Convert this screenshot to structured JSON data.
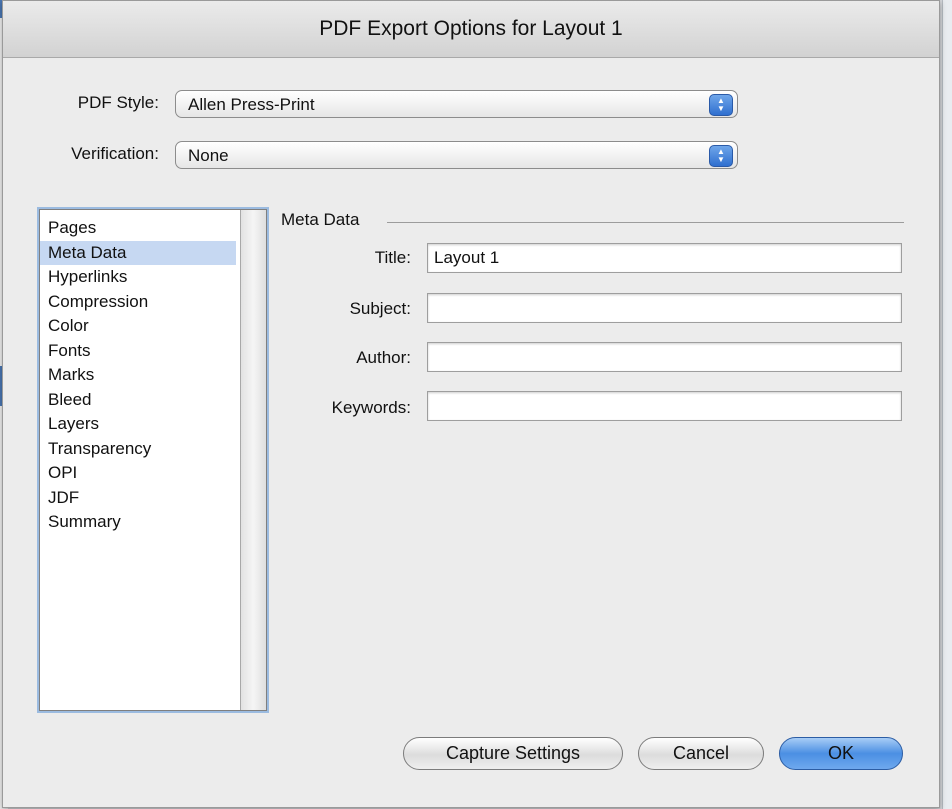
{
  "dialog": {
    "title": "PDF Export Options for Layout 1"
  },
  "pdf_style": {
    "label": "PDF Style:",
    "value": "Allen Press-Print"
  },
  "verification": {
    "label": "Verification:",
    "value": "None"
  },
  "panel_list": {
    "items": [
      {
        "label": "Pages",
        "selected": false
      },
      {
        "label": "Meta Data",
        "selected": true
      },
      {
        "label": "Hyperlinks",
        "selected": false
      },
      {
        "label": "Compression",
        "selected": false
      },
      {
        "label": "Color",
        "selected": false
      },
      {
        "label": "Fonts",
        "selected": false
      },
      {
        "label": "Marks",
        "selected": false
      },
      {
        "label": "Bleed",
        "selected": false
      },
      {
        "label": "Layers",
        "selected": false
      },
      {
        "label": "Transparency",
        "selected": false
      },
      {
        "label": "OPI",
        "selected": false
      },
      {
        "label": "JDF",
        "selected": false
      },
      {
        "label": "Summary",
        "selected": false
      }
    ]
  },
  "meta_data": {
    "group_label": "Meta Data",
    "fields": [
      {
        "label": "Title:",
        "value": "Layout 1"
      },
      {
        "label": "Subject:",
        "value": ""
      },
      {
        "label": "Author:",
        "value": ""
      },
      {
        "label": "Keywords:",
        "value": ""
      }
    ]
  },
  "buttons": {
    "capture": "Capture Settings",
    "cancel": "Cancel",
    "ok": "OK"
  },
  "icons": {
    "popup_arrows": "updown-arrows-icon"
  },
  "colors": {
    "selection": "#c6d8f2",
    "default_button": "#4b8fe3"
  }
}
